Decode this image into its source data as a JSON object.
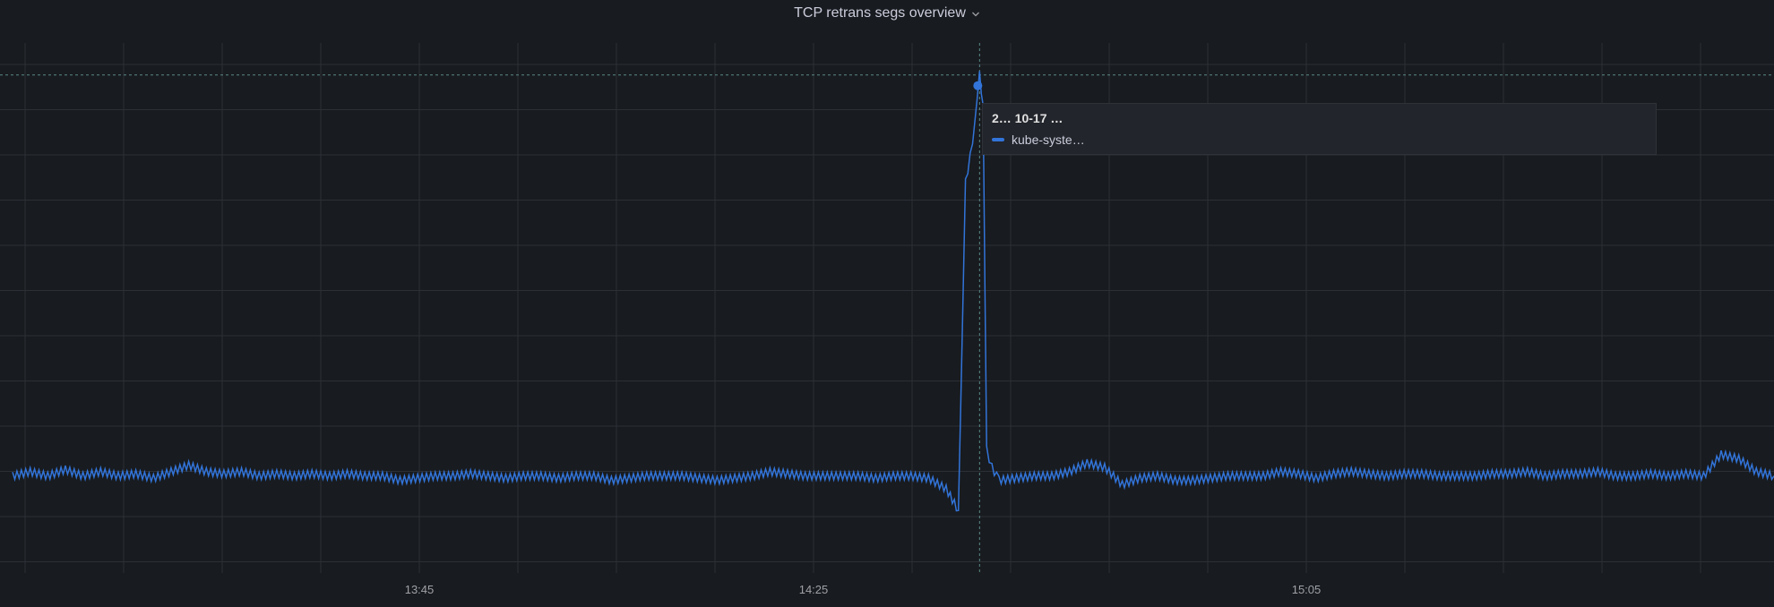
{
  "panel": {
    "title": "TCP retrans segs overview",
    "menu_icon": "chevron-down-icon"
  },
  "colors": {
    "background": "#181b1f",
    "grid": "#2c2f35",
    "series": "#3274d9",
    "crosshair": "#5a8a8a"
  },
  "tooltip": {
    "time": "2… 10-17 …",
    "series_label": "kube-syste…"
  },
  "chart_data": {
    "type": "line",
    "title": "TCP retrans segs overview",
    "xlabel": "",
    "ylabel": "",
    "grid": true,
    "legend": "none",
    "x_ticks": [
      "",
      "",
      "",
      "",
      "13:45",
      "",
      "",
      "",
      "14:25",
      "",
      "",
      "",
      "",
      "15:05",
      "",
      "",
      "",
      "",
      ""
    ],
    "x_range": [
      0,
      100
    ],
    "y_range": [
      0,
      12
    ],
    "series": [
      {
        "color": "#3274d9",
        "points": [
          [
            0,
            2.0
          ],
          [
            1,
            2.1
          ],
          [
            2,
            2.0
          ],
          [
            3,
            2.15
          ],
          [
            4,
            2.0
          ],
          [
            5,
            2.1
          ],
          [
            6,
            2.0
          ],
          [
            7,
            2.05
          ],
          [
            8,
            1.95
          ],
          [
            9,
            2.1
          ],
          [
            10,
            2.25
          ],
          [
            11,
            2.1
          ],
          [
            12,
            2.05
          ],
          [
            13,
            2.1
          ],
          [
            14,
            2.0
          ],
          [
            15,
            2.05
          ],
          [
            16,
            2.0
          ],
          [
            17,
            2.05
          ],
          [
            18,
            2.0
          ],
          [
            19,
            2.05
          ],
          [
            20,
            2.0
          ],
          [
            21,
            2.0
          ],
          [
            22,
            1.9
          ],
          [
            23,
            1.95
          ],
          [
            24,
            2.0
          ],
          [
            25,
            2.0
          ],
          [
            26,
            2.05
          ],
          [
            27,
            2.0
          ],
          [
            28,
            1.95
          ],
          [
            29,
            2.0
          ],
          [
            30,
            2.0
          ],
          [
            31,
            1.95
          ],
          [
            32,
            2.0
          ],
          [
            33,
            2.0
          ],
          [
            34,
            1.9
          ],
          [
            35,
            1.95
          ],
          [
            36,
            2.0
          ],
          [
            37,
            2.0
          ],
          [
            38,
            2.0
          ],
          [
            39,
            1.95
          ],
          [
            40,
            1.9
          ],
          [
            41,
            1.95
          ],
          [
            42,
            2.0
          ],
          [
            43,
            2.1
          ],
          [
            44,
            2.05
          ],
          [
            45,
            2.0
          ],
          [
            46,
            2.0
          ],
          [
            47,
            2.0
          ],
          [
            48,
            2.0
          ],
          [
            49,
            1.95
          ],
          [
            50,
            2.0
          ],
          [
            51,
            2.0
          ],
          [
            52,
            1.95
          ],
          [
            53,
            1.7
          ],
          [
            53.7,
            1.2
          ],
          [
            54.1,
            8.8
          ],
          [
            54.5,
            9.7
          ],
          [
            54.9,
            11.3
          ],
          [
            55.1,
            10.6
          ],
          [
            55.3,
            2.6
          ],
          [
            55.6,
            2.2
          ],
          [
            56,
            1.9
          ],
          [
            57,
            1.95
          ],
          [
            58,
            2.0
          ],
          [
            59,
            2.0
          ],
          [
            60,
            2.1
          ],
          [
            61,
            2.3
          ],
          [
            62,
            2.2
          ],
          [
            63,
            1.8
          ],
          [
            64,
            1.95
          ],
          [
            65,
            2.0
          ],
          [
            66,
            1.9
          ],
          [
            67,
            1.9
          ],
          [
            68,
            1.95
          ],
          [
            69,
            2.0
          ],
          [
            70,
            2.0
          ],
          [
            71,
            2.0
          ],
          [
            72,
            2.1
          ],
          [
            73,
            2.05
          ],
          [
            74,
            1.95
          ],
          [
            75,
            2.05
          ],
          [
            76,
            2.1
          ],
          [
            77,
            2.05
          ],
          [
            78,
            2.0
          ],
          [
            79,
            2.05
          ],
          [
            80,
            2.05
          ],
          [
            81,
            2.0
          ],
          [
            82,
            2.0
          ],
          [
            83,
            2.0
          ],
          [
            84,
            2.05
          ],
          [
            85,
            2.05
          ],
          [
            86,
            2.1
          ],
          [
            87,
            2.0
          ],
          [
            88,
            2.05
          ],
          [
            89,
            2.05
          ],
          [
            90,
            2.1
          ],
          [
            91,
            2.0
          ],
          [
            92,
            2.0
          ],
          [
            93,
            2.05
          ],
          [
            94,
            2.0
          ],
          [
            95,
            2.05
          ],
          [
            96,
            2.0
          ],
          [
            97,
            2.5
          ],
          [
            98,
            2.4
          ],
          [
            99,
            2.1
          ],
          [
            100,
            2.0
          ]
        ]
      }
    ],
    "hover": {
      "x": 54.9,
      "y": 11.3
    }
  }
}
